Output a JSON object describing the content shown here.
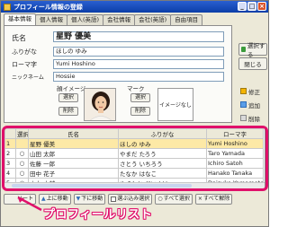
{
  "window": {
    "title": "プロフィール情報の登録"
  },
  "tabs": [
    {
      "label": "基本情報"
    },
    {
      "label": "個人情報"
    },
    {
      "label": "個人(英語)"
    },
    {
      "label": "会社情報"
    },
    {
      "label": "会社(英語)"
    },
    {
      "label": "自由項目"
    }
  ],
  "form": {
    "name_label": "氏名",
    "name_value": "星野 優美",
    "furigana_label": "ふりがな",
    "furigana_value": "ほしの ゆみ",
    "romaji_label": "ローマ字",
    "romaji_value": "Yumi Hoshino",
    "nickname_label": "ニックネーム",
    "nickname_value": "Hossie",
    "face_image_label": "顔イメージ",
    "mark_label": "マーク",
    "select_label": "選択",
    "delete_label": "削除",
    "mark_placeholder": "イメージなし"
  },
  "side_buttons": {
    "select": "選択する",
    "close": "閉じる",
    "edit": "修正",
    "add": "追加",
    "remove": "削除"
  },
  "list": {
    "headers": [
      "選択",
      "氏名",
      "ふりがな",
      "ローマ字"
    ],
    "rows": [
      {
        "no": "1",
        "mark": "",
        "name": "星野 優美",
        "kana": "ほしの ゆみ",
        "romaji": "Yumi Hoshino"
      },
      {
        "no": "2",
        "mark": "○",
        "name": "山田 太郎",
        "kana": "やまだ たろう",
        "romaji": "Taro Yamada"
      },
      {
        "no": "3",
        "mark": "○",
        "name": "佐藤 一郎",
        "kana": "さとう いちろう",
        "romaji": "Ichiro Satoh"
      },
      {
        "no": "4",
        "mark": "○",
        "name": "田中 花子",
        "kana": "たなか はなこ",
        "romaji": "Hanako Tanaka"
      },
      {
        "no": "5",
        "mark": "○",
        "name": "山本 大輔",
        "kana": "やまもと だいすけ",
        "romaji": "Daisuke Yamamoto"
      }
    ]
  },
  "bottom_bar": {
    "sort": "ソート",
    "move_up": "上に移動",
    "move_down": "下に移動",
    "select_only": "選ぶ込み選択",
    "select_all": "すべて選択",
    "clear_all": "すべて解除"
  },
  "caption": "プロフィールリスト",
  "colors": {
    "highlight": "#e0106a",
    "selected_row": "#fde9a6",
    "titlebar": "#0b3ea8"
  }
}
